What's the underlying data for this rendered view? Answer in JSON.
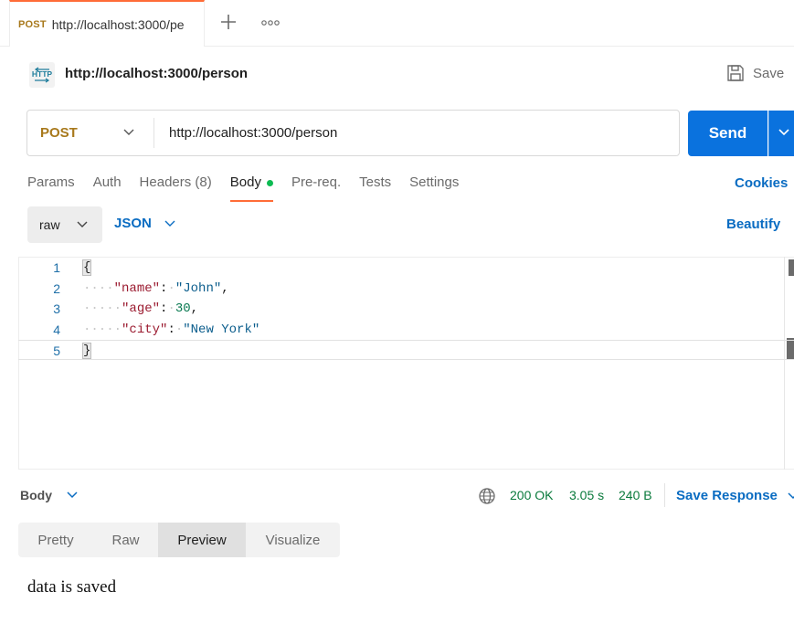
{
  "tab": {
    "method": "POST",
    "url": "http://localhost:3000/pe"
  },
  "icons": {
    "new_tab": "plus-icon",
    "more": "more-horizontal-icon",
    "http": "http-request-icon",
    "save": "save-disk-icon",
    "globe": "globe-icon"
  },
  "request": {
    "name": "http://localhost:3000/person",
    "save_label": "Save",
    "method": "POST",
    "url": "http://localhost:3000/person",
    "send_label": "Send"
  },
  "request_tabs": [
    {
      "label": "Params"
    },
    {
      "label": "Auth"
    },
    {
      "label": "Headers (8)"
    },
    {
      "label": "Body",
      "active": true
    },
    {
      "label": "Pre-req."
    },
    {
      "label": "Tests"
    },
    {
      "label": "Settings"
    }
  ],
  "cookies_label": "Cookies",
  "body_mode": {
    "type": "raw",
    "format": "JSON",
    "beautify_label": "Beautify"
  },
  "editor": {
    "line_numbers": [
      "1",
      "2",
      "3",
      "4",
      "5"
    ],
    "lines": [
      {
        "open": "{"
      },
      {
        "key": "\"name\"",
        "value": "\"John\"",
        "trail": ","
      },
      {
        "key": "\"age\"",
        "value": "30",
        "trail": ", "
      },
      {
        "key": "\"city\"",
        "value": "\"New York\"",
        "trail": ""
      },
      {
        "close": "}"
      }
    ]
  },
  "response": {
    "section_label": "Body",
    "status": "200 OK",
    "time": "3.05 s",
    "size": "240 B",
    "save_response_label": "Save Response",
    "view_tabs": [
      {
        "label": "Pretty"
      },
      {
        "label": "Raw"
      },
      {
        "label": "Preview",
        "active": true
      },
      {
        "label": "Visualize"
      }
    ],
    "preview_text": "data is saved"
  },
  "colors": {
    "accent": "#ff6c37",
    "primary": "#0a72de",
    "method_post": "#a8791c",
    "status_ok": "#0a7a3c",
    "link": "#0a6cc2"
  }
}
